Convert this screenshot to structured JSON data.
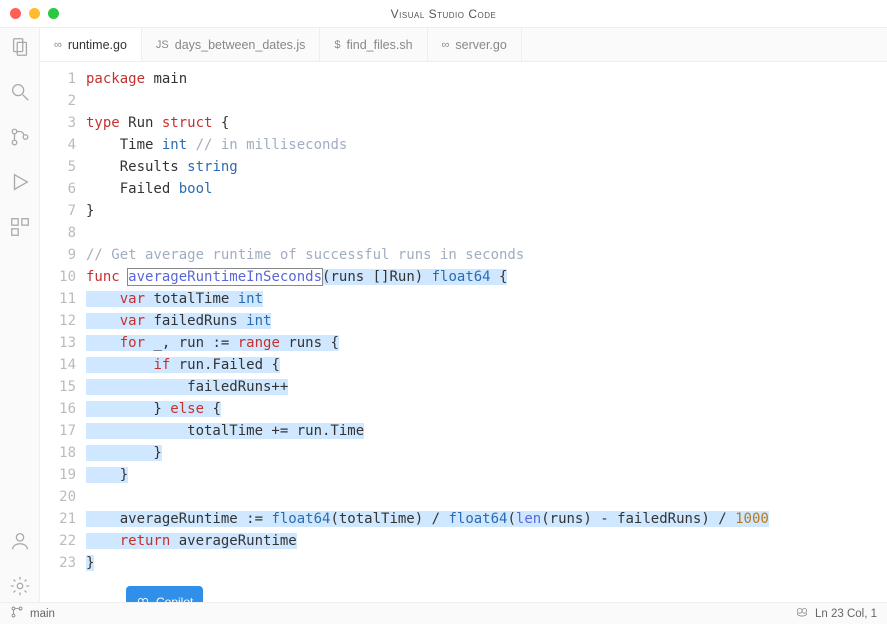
{
  "title": "Visual Studio Code",
  "tabs": [
    {
      "icon": "go",
      "label": "runtime.go",
      "active": true
    },
    {
      "icon": "js",
      "label": "days_between_dates.js",
      "active": false
    },
    {
      "icon": "sh",
      "label": "find_files.sh",
      "active": false
    },
    {
      "icon": "go",
      "label": "server.go",
      "active": false
    }
  ],
  "icon_glyphs": {
    "go": "∞",
    "js": "JS",
    "sh": "$"
  },
  "code_lines": [
    [
      {
        "t": "package ",
        "c": "kw"
      },
      {
        "t": "main",
        "c": "id"
      }
    ],
    [],
    [
      {
        "t": "type ",
        "c": "kw"
      },
      {
        "t": "Run ",
        "c": "id"
      },
      {
        "t": "struct ",
        "c": "kw"
      },
      {
        "t": "{",
        "c": "blk"
      }
    ],
    [
      {
        "t": "    Time ",
        "c": "id"
      },
      {
        "t": "int ",
        "c": "ty"
      },
      {
        "t": "// in milliseconds",
        "c": "cm"
      }
    ],
    [
      {
        "t": "    Results ",
        "c": "id"
      },
      {
        "t": "string",
        "c": "ty"
      }
    ],
    [
      {
        "t": "    Failed ",
        "c": "id"
      },
      {
        "t": "bool",
        "c": "ty"
      }
    ],
    [
      {
        "t": "}",
        "c": "blk"
      }
    ],
    [],
    [
      {
        "t": "// Get average runtime of successful runs in seconds",
        "c": "cm"
      }
    ],
    [
      {
        "t": "func ",
        "c": "kw"
      },
      {
        "t": "averageRuntimeInSeconds",
        "c": "fn",
        "box": true
      },
      {
        "t": "(runs []Run) ",
        "c": "id",
        "sel": true
      },
      {
        "t": "float64 ",
        "c": "ty",
        "sel": true
      },
      {
        "t": "{",
        "c": "blk",
        "sel": true
      }
    ],
    [
      {
        "t": "    ",
        "sel": true
      },
      {
        "t": "var ",
        "c": "kw",
        "sel": true
      },
      {
        "t": "totalTime ",
        "c": "id",
        "sel": true
      },
      {
        "t": "int",
        "c": "ty",
        "sel": true
      }
    ],
    [
      {
        "t": "    ",
        "sel": true
      },
      {
        "t": "var ",
        "c": "kw",
        "sel": true
      },
      {
        "t": "failedRuns ",
        "c": "id",
        "sel": true
      },
      {
        "t": "int",
        "c": "ty",
        "sel": true
      }
    ],
    [
      {
        "t": "    ",
        "sel": true
      },
      {
        "t": "for ",
        "c": "kw",
        "sel": true
      },
      {
        "t": "_, run := ",
        "c": "id",
        "sel": true
      },
      {
        "t": "range ",
        "c": "kw",
        "sel": true
      },
      {
        "t": "runs {",
        "c": "id",
        "sel": true
      }
    ],
    [
      {
        "t": "        ",
        "sel": true
      },
      {
        "t": "if ",
        "c": "kw",
        "sel": true
      },
      {
        "t": "run.Failed {",
        "c": "id",
        "sel": true
      }
    ],
    [
      {
        "t": "            failedRuns++",
        "c": "id",
        "sel": true
      }
    ],
    [
      {
        "t": "        } ",
        "c": "id",
        "sel": true
      },
      {
        "t": "else ",
        "c": "kw",
        "sel": true
      },
      {
        "t": "{",
        "c": "id",
        "sel": true
      }
    ],
    [
      {
        "t": "            totalTime += run.Time",
        "c": "id",
        "sel": true
      }
    ],
    [
      {
        "t": "        }",
        "c": "id",
        "sel": true
      }
    ],
    [
      {
        "t": "    }",
        "c": "id",
        "sel": true
      }
    ],
    [],
    [
      {
        "t": "    averageRuntime := ",
        "c": "id",
        "sel": true
      },
      {
        "t": "float64",
        "c": "ty",
        "sel": true
      },
      {
        "t": "(totalTime) / ",
        "c": "id",
        "sel": true
      },
      {
        "t": "float64",
        "c": "ty",
        "sel": true
      },
      {
        "t": "(",
        "c": "id",
        "sel": true
      },
      {
        "t": "len",
        "c": "fn",
        "sel": true
      },
      {
        "t": "(runs) - failedRuns) / ",
        "c": "id",
        "sel": true
      },
      {
        "t": "1000",
        "c": "num",
        "sel": true
      }
    ],
    [
      {
        "t": "    ",
        "sel": true
      },
      {
        "t": "return ",
        "c": "kw",
        "sel": true
      },
      {
        "t": "averageRuntime",
        "c": "id",
        "sel": true
      }
    ],
    [
      {
        "t": "}",
        "c": "id",
        "sel": true
      }
    ]
  ],
  "copilot_label": "Copilot",
  "status": {
    "branch": "main",
    "cursor": "Ln 23 Col, 1"
  }
}
